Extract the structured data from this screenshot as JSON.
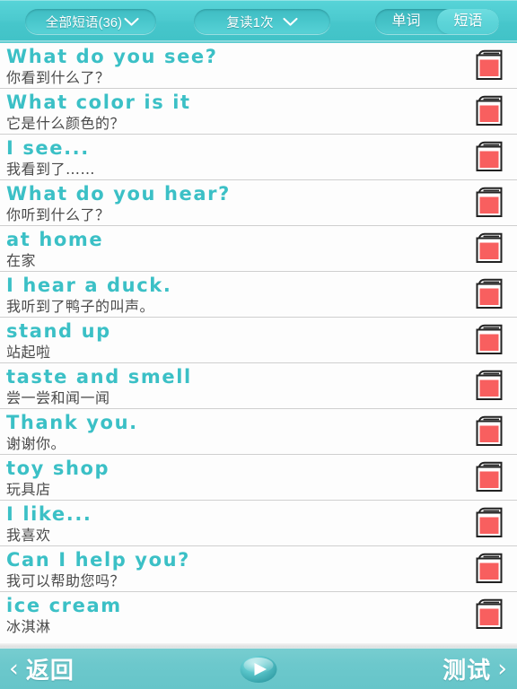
{
  "topbar": {
    "scope_filter": {
      "label": "全部短语(36)",
      "icon": "chevron-down-icon"
    },
    "repeat_filter": {
      "label": "复读1次",
      "icon": "chevron-down-icon"
    },
    "segmented": {
      "options": [
        "单词",
        "短语"
      ],
      "selected": "短语"
    }
  },
  "list": {
    "items": [
      {
        "en": "What do you see?",
        "zh": "你看到什么了？",
        "icon": "book-icon"
      },
      {
        "en": "What color is it",
        "zh": "它是什么颜色的？",
        "icon": "book-icon"
      },
      {
        "en": "I see...",
        "zh": "我看到了……",
        "icon": "book-icon"
      },
      {
        "en": "What do you hear?",
        "zh": "你听到什么了？",
        "icon": "book-icon"
      },
      {
        "en": "at home",
        "zh": "在家",
        "icon": "book-icon"
      },
      {
        "en": "I hear a duck.",
        "zh": "我听到了鸭子的叫声。",
        "icon": "book-icon"
      },
      {
        "en": "stand up",
        "zh": "站起啦",
        "icon": "book-icon"
      },
      {
        "en": "taste and smell",
        "zh": "尝一尝和闻一闻",
        "icon": "book-icon"
      },
      {
        "en": "Thank you.",
        "zh": "谢谢你。",
        "icon": "book-icon"
      },
      {
        "en": "toy shop",
        "zh": "玩具店",
        "icon": "book-icon"
      },
      {
        "en": "I like...",
        "zh": "我喜欢",
        "icon": "book-icon"
      },
      {
        "en": "Can I help you?",
        "zh": "我可以帮助您吗？",
        "icon": "book-icon"
      },
      {
        "en": "ice cream",
        "zh": "冰淇淋",
        "icon": "book-icon"
      }
    ]
  },
  "bottombar": {
    "back_label": "返回",
    "back_arrow": "‹",
    "test_label": "测试",
    "test_arrow": "›",
    "play_icon": "play-icon"
  },
  "colors": {
    "topbar_teal": "#4ccacf",
    "bottombar_teal": "#6cc8cc",
    "english_text": "#3bc0c6",
    "chinese_text": "#4a4a4a",
    "book_cover": "#f85f5f",
    "row_divider": "#cfcfcf"
  }
}
